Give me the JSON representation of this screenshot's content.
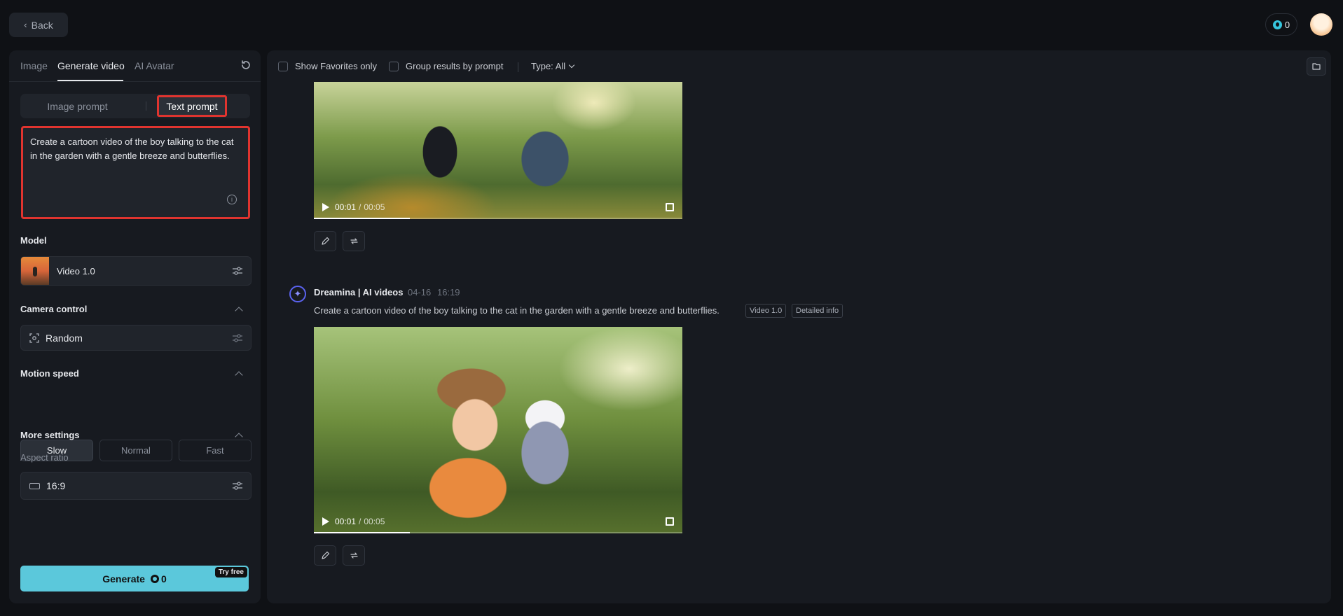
{
  "header": {
    "back_label": "Back",
    "credits": "0"
  },
  "left": {
    "tabs": [
      {
        "label": "Image"
      },
      {
        "label": "Generate video"
      },
      {
        "label": "AI Avatar"
      }
    ],
    "prompt_modes": [
      {
        "label": "Image prompt"
      },
      {
        "label": "Text prompt"
      }
    ],
    "prompt_text": "Create a cartoon video of the boy talking to the cat in the garden with a gentle breeze and butterflies.",
    "model": {
      "section_label": "Model",
      "value": "Video 1.0"
    },
    "camera": {
      "section_label": "Camera control",
      "value": "Random"
    },
    "motion": {
      "section_label": "Motion speed",
      "options": [
        "Slow",
        "Normal",
        "Fast"
      ],
      "selected": "Slow"
    },
    "more_settings": {
      "section_label": "More settings",
      "aspect_label": "Aspect ratio",
      "aspect_value": "16:9"
    },
    "generate": {
      "label": "Generate",
      "cost": "0",
      "badge": "Try free"
    }
  },
  "filters": {
    "favorites_label": "Show Favorites only",
    "group_label": "Group results by prompt",
    "type_label": "Type: All"
  },
  "results": [
    {
      "time_current": "00:01",
      "time_sep": "/",
      "time_total": "00:05",
      "progress": 0.26
    },
    {
      "author": "Dreamina | AI videos",
      "date": "04-16",
      "time": "16:19",
      "prompt": "Create a cartoon video of the boy talking to the cat in the garden with a gentle breeze and butterflies.",
      "tags": [
        "Video 1.0",
        "Detailed info"
      ],
      "time_current": "00:01",
      "time_sep": "/",
      "time_total": "00:05",
      "progress": 0.26
    }
  ],
  "colors": {
    "accent": "#5bc8db",
    "highlight_box": "#e0342f"
  }
}
